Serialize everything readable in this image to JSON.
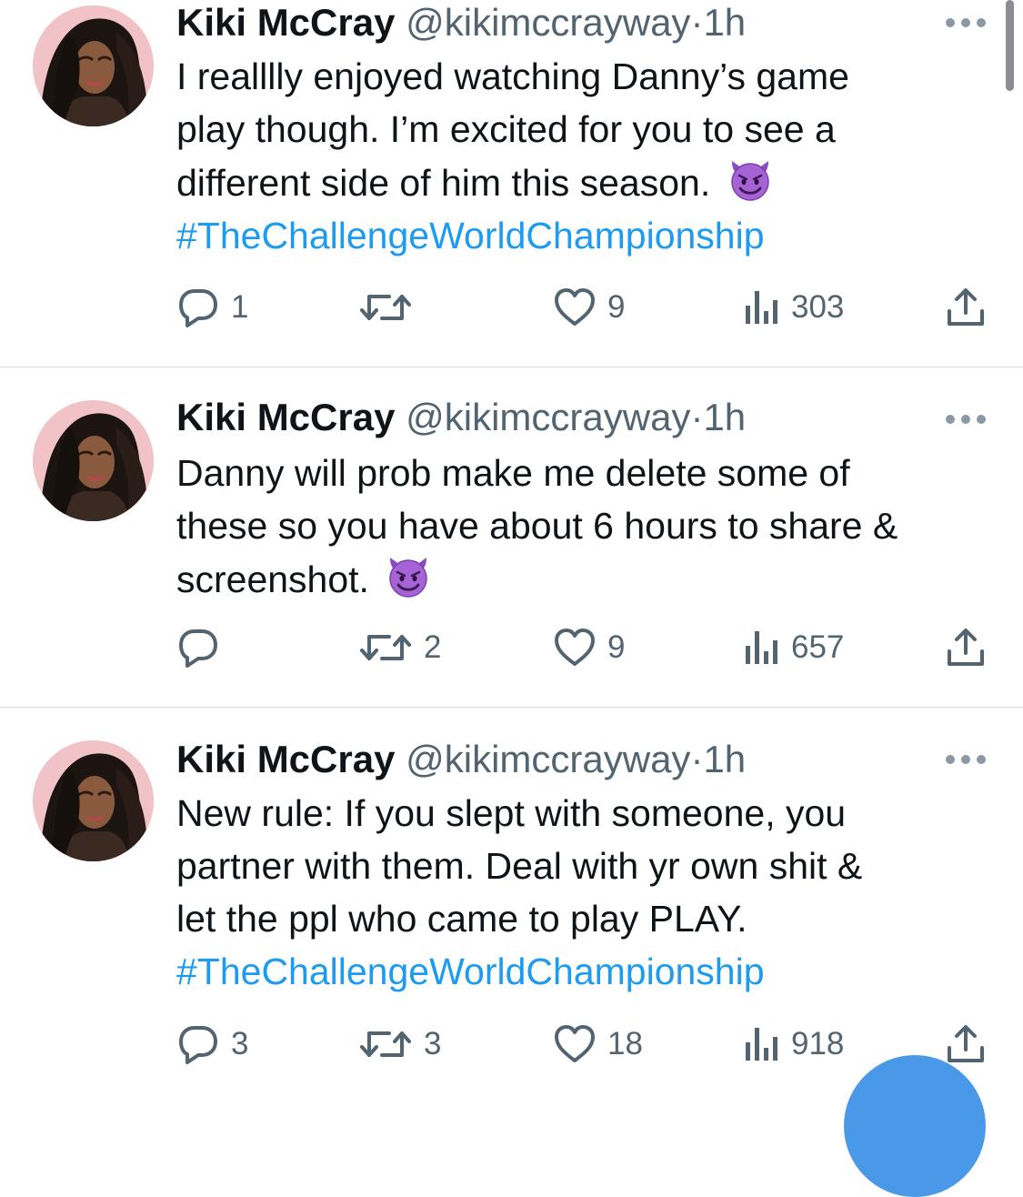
{
  "tweets": [
    {
      "name": "Kiki McCray",
      "handle": "@kikimccrayway",
      "separator": "·",
      "time": "1h",
      "lines": [
        "I realllly enjoyed watching Danny’s game",
        "play though. I’m excited for you to see a",
        "different side of him this season."
      ],
      "emoji": "smiling-devil-emoji",
      "hashtag": "#TheChallengeWorldChampionship",
      "replies": "1",
      "retweets": "",
      "likes": "9",
      "views": "303"
    },
    {
      "name": "Kiki McCray",
      "handle": "@kikimccrayway",
      "separator": "·",
      "time": "1h",
      "lines": [
        "Danny will prob make me delete some of",
        "these so you have about 6 hours to share &",
        "screenshot."
      ],
      "emoji": "smiling-devil-emoji",
      "hashtag": "",
      "replies": "",
      "retweets": "2",
      "likes": "9",
      "views": "657"
    },
    {
      "name": "Kiki McCray",
      "handle": "@kikimccrayway",
      "separator": "·",
      "time": "1h",
      "lines": [
        "New rule: If you slept with someone, you",
        "partner with them. Deal with yr own shit &",
        "let the ppl who came to play PLAY."
      ],
      "emoji": "",
      "hashtag": "#TheChallengeWorldChampionship",
      "replies": "3",
      "retweets": "3",
      "likes": "18",
      "views": "918"
    }
  ],
  "colors": {
    "text": "#0f1419",
    "secondary": "#536471",
    "link": "#1d9bf0",
    "divider": "#d6dadd",
    "fab": "#4a99e9",
    "avatar_bg": "#f1c3c6"
  },
  "icons": [
    "reply-icon",
    "retweet-icon",
    "like-icon",
    "views-icon",
    "share-icon",
    "more-options-icon"
  ]
}
